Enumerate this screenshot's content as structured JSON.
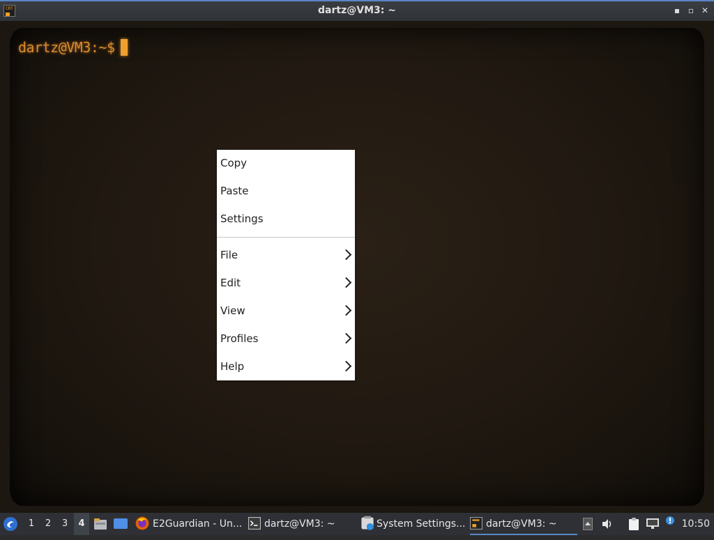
{
  "window": {
    "title": "dartz@VM3: ~",
    "icon": "crt-terminal-icon",
    "icon_text": "CRT",
    "buttons": {
      "minimize": "minimize-icon",
      "maximize": "maximize-icon",
      "close": "close-icon",
      "minimize_glyph": "▪",
      "maximize_glyph": "▫",
      "close_glyph": "✕"
    }
  },
  "terminal": {
    "prompt": "dartz@VM3:~$",
    "text_color": "#d98a2c",
    "background": "#1c1711"
  },
  "context_menu": {
    "items": [
      {
        "label": "Copy",
        "submenu": false
      },
      {
        "label": "Paste",
        "submenu": false
      },
      {
        "label": "Settings",
        "submenu": false
      },
      {
        "label": "File",
        "submenu": true
      },
      {
        "label": "Edit",
        "submenu": true
      },
      {
        "label": "View",
        "submenu": true
      },
      {
        "label": "Profiles",
        "submenu": true
      },
      {
        "label": "Help",
        "submenu": true
      }
    ]
  },
  "taskbar": {
    "start_icon": "start-menu-icon",
    "workspaces": [
      "1",
      "2",
      "3",
      "4"
    ],
    "active_workspace": "4",
    "launchers": [
      "file-manager-icon",
      "show-desktop-icon"
    ],
    "tasks": [
      {
        "label": "E2Guardian - Un...",
        "icon": "firefox-icon"
      },
      {
        "label": "dartz@VM3: ~",
        "icon": "terminal-icon"
      },
      {
        "label": "System Settings...",
        "icon": "system-settings-icon"
      },
      {
        "label": "dartz@VM3: ~",
        "icon": "crt-terminal-icon",
        "active": true
      }
    ],
    "tray": [
      "tray-up-arrow-icon",
      "volume-icon",
      "clipboard-icon",
      "network-icon",
      "update-notifier-icon"
    ],
    "clock": "10:50"
  }
}
